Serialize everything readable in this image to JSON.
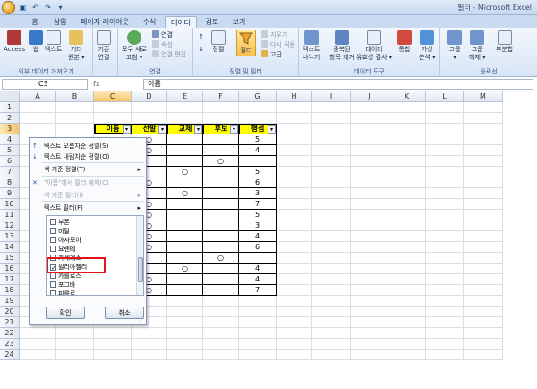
{
  "window": {
    "title": "필터 - Microsoft Excel"
  },
  "tabs": [
    {
      "label": "홈"
    },
    {
      "label": "삽입"
    },
    {
      "label": "페이지 레이아웃"
    },
    {
      "label": "수식"
    },
    {
      "label": "데이터",
      "active": true
    },
    {
      "label": "검토"
    },
    {
      "label": "보기"
    }
  ],
  "ribbon": {
    "external": {
      "label": "외부 데이터 가져오기",
      "access": "Access",
      "web": "웹",
      "text": "텍스트",
      "other": "기타",
      "other2": "원본 ▾",
      "existing": "기존",
      "existing2": "연결"
    },
    "connections": {
      "label": "연결",
      "refresh": "모두 새로",
      "refresh2": "고침 ▾",
      "conn": "연결",
      "props": "속성",
      "edit": "연결 편집"
    },
    "sortfilter": {
      "label": "정렬 및 필터",
      "sort": "정렬",
      "filter": "필터",
      "clear": "지우기",
      "reapply": "다시 적용",
      "advanced": "고급"
    },
    "tools": {
      "label": "데이터 도구",
      "t2c": "텍스트",
      "t2c2": "나누기",
      "dup": "중복된",
      "dup2": "항목 제거",
      "valid": "데이터",
      "valid2": "유효성 검사 ▾",
      "consol": "통합",
      "whatif": "가상",
      "whatif2": "분석 ▾"
    },
    "outline": {
      "label": "윤곽선",
      "group": "그룹",
      "group2": "▾",
      "ungroup": "그룹",
      "ungroup2": "해제 ▾",
      "subtotal": "부분합"
    }
  },
  "formula_bar": {
    "name_box": "C3",
    "fx": "fx",
    "content": "이름"
  },
  "columns": [
    "A",
    "B",
    "C",
    "D",
    "E",
    "F",
    "G",
    "H",
    "I",
    "J",
    "K",
    "L",
    "M"
  ],
  "rows": [
    "1",
    "2",
    "3",
    "4",
    "5",
    "6",
    "7",
    "8",
    "9",
    "10",
    "11",
    "12",
    "13",
    "14",
    "15",
    "16",
    "17",
    "18",
    "19",
    "20",
    "21",
    "22",
    "23",
    "24"
  ],
  "table": {
    "headers": [
      "이름",
      "선발",
      "교체",
      "후보",
      "평점"
    ],
    "data": [
      [
        "",
        "○",
        "",
        "",
        "5"
      ],
      [
        "",
        "○",
        "",
        "",
        "4"
      ],
      [
        "",
        "",
        "",
        "○",
        ""
      ],
      [
        "",
        "",
        "○",
        "",
        "5"
      ],
      [
        "",
        "○",
        "",
        "",
        "6"
      ],
      [
        "",
        "",
        "○",
        "",
        "3"
      ],
      [
        "",
        "○",
        "",
        "",
        "7"
      ],
      [
        "",
        "○",
        "",
        "",
        "5"
      ],
      [
        "",
        "○",
        "",
        "",
        "3"
      ],
      [
        "",
        "○",
        "",
        "",
        "4"
      ],
      [
        "",
        "○",
        "",
        "",
        "6"
      ],
      [
        "",
        "",
        "",
        "○",
        ""
      ],
      [
        "",
        "",
        "○",
        "",
        "4"
      ],
      [
        "",
        "○",
        "",
        "",
        "4"
      ],
      [
        "",
        "○",
        "",
        "",
        "7"
      ]
    ]
  },
  "filter_menu": {
    "items": [
      {
        "label": "텍스트 오름차순 정렬(S)",
        "icon": "↑",
        "disabled": false
      },
      {
        "label": "텍스트 내림차순 정렬(O)",
        "icon": "↓",
        "disabled": false
      },
      {
        "label": "색 기준 정렬(T)",
        "icon": "",
        "disabled": false,
        "submenu": true
      },
      {
        "label": "\"이름\"에서 필터 해제(C)",
        "icon": "✕",
        "disabled": true
      },
      {
        "label": "색 기준 필터(I)",
        "icon": "",
        "disabled": true,
        "submenu": true
      },
      {
        "label": "텍스트 필터(F)",
        "icon": "",
        "disabled": false,
        "submenu": true
      }
    ],
    "list": [
      {
        "label": "부폰",
        "checked": false
      },
      {
        "label": "비달",
        "checked": false
      },
      {
        "label": "아사모아",
        "checked": false
      },
      {
        "label": "요렌테",
        "checked": false
      },
      {
        "label": "카세레스",
        "checked": false
      },
      {
        "label": "필리아첼리",
        "checked": true
      },
      {
        "label": "카를로스",
        "checked": false
      },
      {
        "label": "포그바",
        "checked": false
      },
      {
        "label": "피를로",
        "checked": false
      }
    ],
    "ok": "확인",
    "cancel": "취소"
  }
}
